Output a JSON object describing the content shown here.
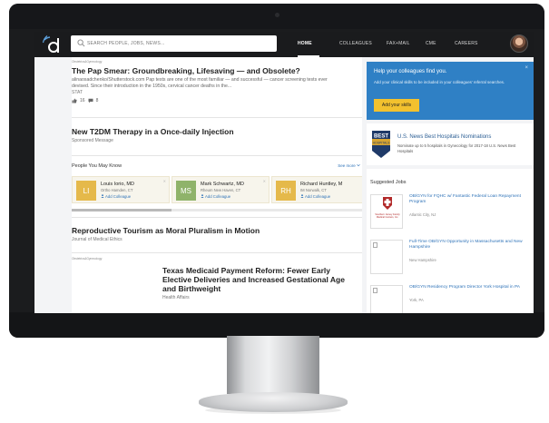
{
  "nav": {
    "search_placeholder": "SEARCH PEOPLE, JOBS, NEWS...",
    "links": [
      "HOME",
      "COLLEAGUES",
      "FAX+MAIL",
      "CME",
      "CAREERS"
    ]
  },
  "feed": {
    "article1": {
      "tag": "Obstetrics&Gynecology",
      "headline": "The Pap Smear: Groundbreaking, Lifesaving — and Obsolete?",
      "snippet": "alinaosadchenko/Shutterstock.com Pap tests are one of the most familiar — and successful — cancer screening tests ever devised. Since their introduction in the 1950s, cervical cancer deaths in the...",
      "source": "STAT",
      "likes": "16",
      "comments": "8"
    },
    "sponsored": {
      "headline": "New T2DM Therapy in a Once-daily Injection",
      "label": "Sponsored Message"
    },
    "pymk": {
      "title": "People You May Know",
      "see_more": "See more",
      "people": [
        {
          "initials": "LI",
          "name": "Louis Iorio, MD",
          "location": "Ortho Hamden, CT",
          "action": "Add Colleague",
          "color": "#e5b94a"
        },
        {
          "initials": "MS",
          "name": "Mark Schwartz, MD",
          "location": "Rheum New Haven, CT",
          "action": "Add Colleague",
          "color": "#8fb36a"
        },
        {
          "initials": "RH",
          "name": "Richard Huntley, M",
          "location": "IM Norwalk, CT",
          "action": "Add Colleague",
          "color": "#e5b94a"
        }
      ]
    },
    "article2": {
      "headline": "Reproductive Tourism as Moral Pluralism in Motion",
      "source": "Journal of Medical Ethics"
    },
    "article3": {
      "tag": "Obstetrics&Gynecology",
      "headline": "Texas Medicaid Payment Reform: Fewer Early Elective Deliveries and Increased Gestational Age and Birthweight",
      "source": "Health Affairs"
    }
  },
  "rail": {
    "promo": {
      "title": "Help your colleagues find you.",
      "text": "Add your clinical skills to be included in your colleagues' referral searches.",
      "button": "Add your skills",
      "close": "×"
    },
    "best": {
      "badge_line1": "BEST",
      "badge_line2": "HOSPITALS",
      "title": "U.S. News Best Hospitals Nominations",
      "text": "Nominate up to 5 hospitals in Gynecology for 2017-18 U.S. News Best Hospitals"
    },
    "jobs": {
      "title": "Suggested Jobs",
      "items": [
        {
          "title": "OB/GYN for FQHC w/ Fantastic Federal Loan Repayment Program",
          "location": "Atlantic City, NJ",
          "logo_text": "Southern Jersey Family Medical Centers, Inc."
        },
        {
          "title": "Full-Time OB/GYN Opportunity in Massachusetts and New Hampshire",
          "location": "New Hampshire",
          "logo_text": ""
        },
        {
          "title": "OB/GYN Residency Program Director York Hospital in PA",
          "location": "York, PA",
          "logo_text": ""
        }
      ]
    }
  },
  "colors": {
    "nav_bg": "#1a1b1d",
    "promo_bg": "#2f80c5",
    "promo_button": "#f2c12e",
    "link": "#2f73b8"
  }
}
